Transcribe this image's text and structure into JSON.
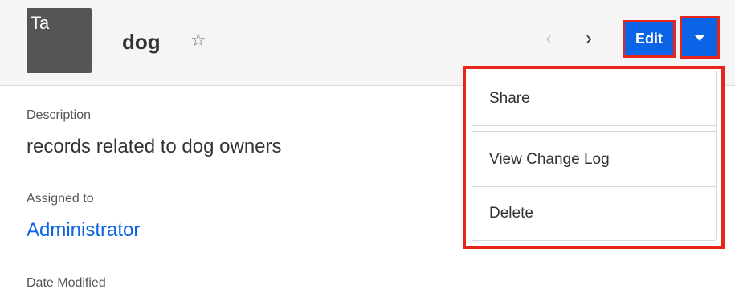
{
  "record": {
    "avatar_text": "Ta",
    "title": "dog"
  },
  "header": {
    "favorite_icon": "star-outline-icon",
    "prev_icon": "chevron-left-icon",
    "next_icon": "chevron-right-icon",
    "edit_label": "Edit",
    "actions_icon": "caret-down-icon",
    "accent_color": "#0b63e5",
    "highlight_color": "#e8251a"
  },
  "fields": {
    "description": {
      "label": "Description",
      "value": "records related to dog owners"
    },
    "assigned_to": {
      "label": "Assigned to",
      "value": "Administrator"
    },
    "date_modified": {
      "label": "Date Modified"
    }
  },
  "actions_menu": {
    "items": [
      {
        "label": "Share"
      },
      {
        "label": "View Change Log"
      },
      {
        "label": "Delete"
      }
    ]
  }
}
